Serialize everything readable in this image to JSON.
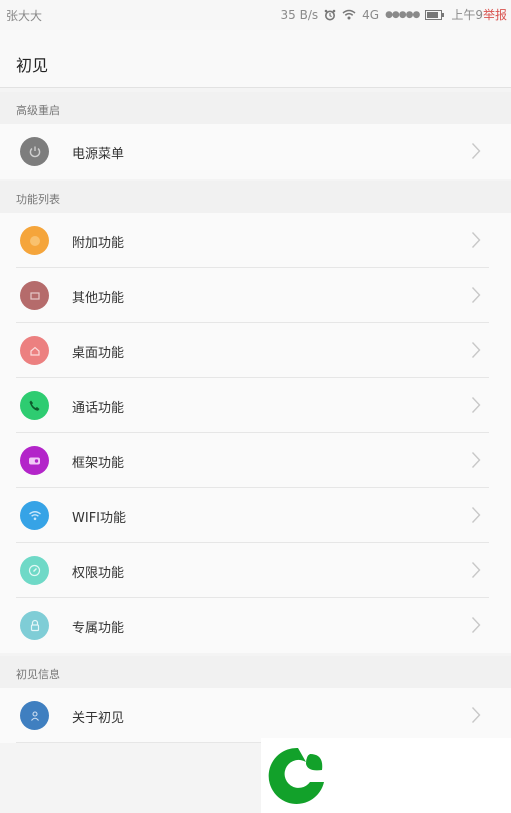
{
  "status_bar": {
    "carrier": "张大大",
    "speed": "35 B/s",
    "network": "4G",
    "signal": "●●●●●",
    "time": "上午9",
    "report": "举报"
  },
  "app_bar": {
    "title": "初见"
  },
  "sections": [
    {
      "header": "高级重启",
      "items": [
        {
          "label": "电源菜单",
          "icon": "power-icon",
          "color": "#7d7d7d"
        }
      ]
    },
    {
      "header": "功能列表",
      "items": [
        {
          "label": "附加功能",
          "icon": "addon-icon",
          "color": "#f5a53b"
        },
        {
          "label": "其他功能",
          "icon": "other-icon",
          "color": "#b56b6b"
        },
        {
          "label": "桌面功能",
          "icon": "home-icon",
          "color": "#ec8080"
        },
        {
          "label": "通话功能",
          "icon": "phone-icon",
          "color": "#2ecc71"
        },
        {
          "label": "框架功能",
          "icon": "frame-icon",
          "color": "#b325c9"
        },
        {
          "label": "WIFI功能",
          "icon": "wifi-icon",
          "color": "#36a3e6"
        },
        {
          "label": "权限功能",
          "icon": "permission-icon",
          "color": "#6fd9c7"
        },
        {
          "label": "专属功能",
          "icon": "lock-icon",
          "color": "#7fcdd6"
        }
      ]
    },
    {
      "header": "初见信息",
      "items": [
        {
          "label": "关于初见",
          "icon": "about-icon",
          "color": "#3f7fc0"
        }
      ]
    }
  ],
  "logo": {
    "icon": "watermark-logo",
    "color": "#12a12a"
  }
}
